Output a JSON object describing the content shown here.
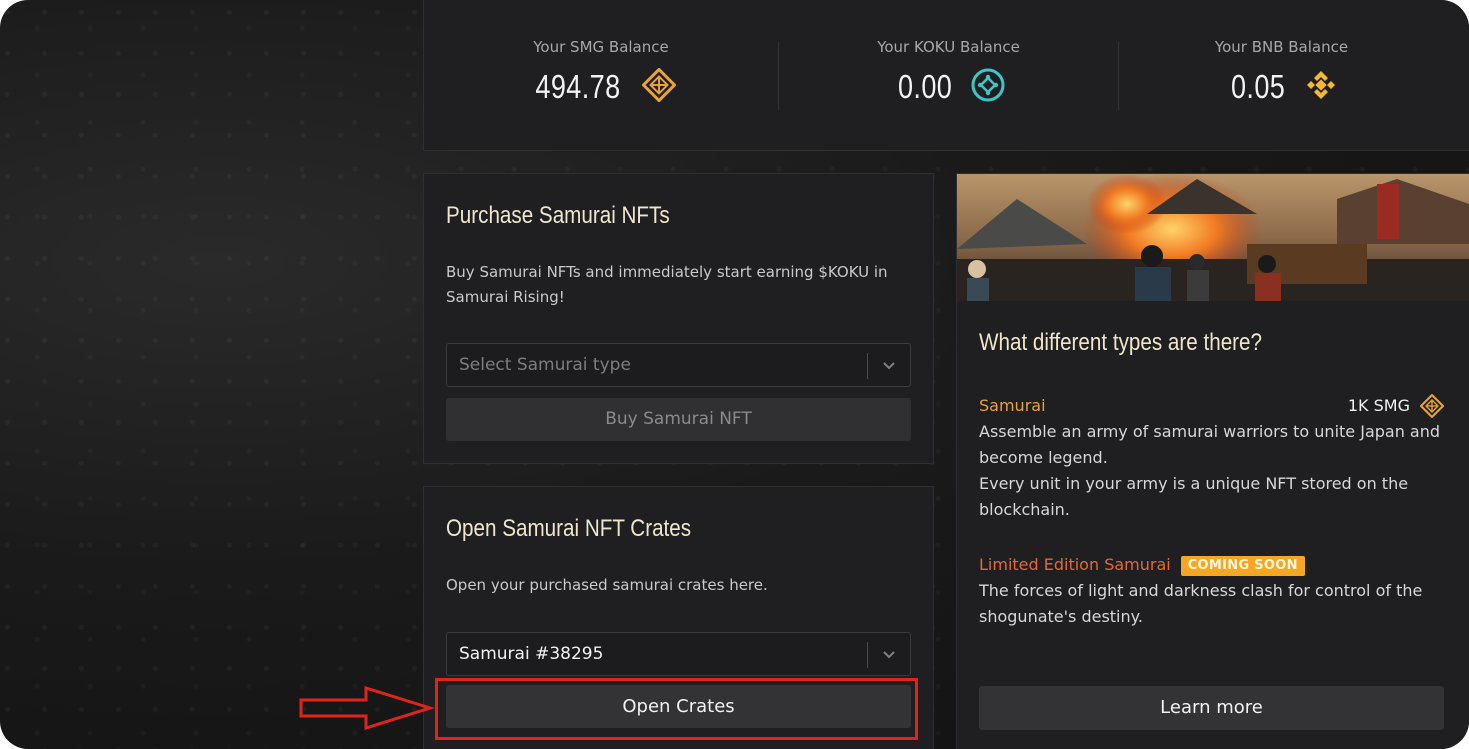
{
  "balances": [
    {
      "label": "Your SMG Balance",
      "value": "494.78",
      "icon": "smg-icon"
    },
    {
      "label": "Your KOKU Balance",
      "value": "0.00",
      "icon": "koku-icon"
    },
    {
      "label": "Your BNB Balance",
      "value": "0.05",
      "icon": "bnb-icon"
    }
  ],
  "purchase": {
    "title": "Purchase Samurai NFTs",
    "description": "Buy Samurai NFTs and immediately start earning $KOKU in Samurai Rising!",
    "select_placeholder": "Select Samurai type",
    "buy_label": "Buy Samurai NFT"
  },
  "crates": {
    "title": "Open Samurai NFT Crates",
    "description": "Open your purchased samurai crates here.",
    "select_value": "Samurai #38295",
    "open_label": "Open Crates"
  },
  "types": {
    "title": "What different types are there?",
    "samurai_name": "Samurai",
    "samurai_price": "1K SMG",
    "samurai_desc_1": "Assemble an army of samurai warriors to unite Japan and become legend.",
    "samurai_desc_2": "Every unit in your army is a unique NFT stored on the blockchain.",
    "limited_name": "Limited Edition Samurai",
    "limited_badge": "COMING SOON",
    "limited_desc": "The forces of light and darkness clash for control of the shogunate's destiny.",
    "learn_more_label": "Learn more"
  },
  "colors": {
    "accent_gold": "#e8a23a",
    "koku_teal": "#3ec6c6",
    "bnb_yellow": "#f3ba2f",
    "limited_orange": "#e06a35",
    "badge_bg": "#f5a623",
    "highlight_red": "#e0241c"
  }
}
